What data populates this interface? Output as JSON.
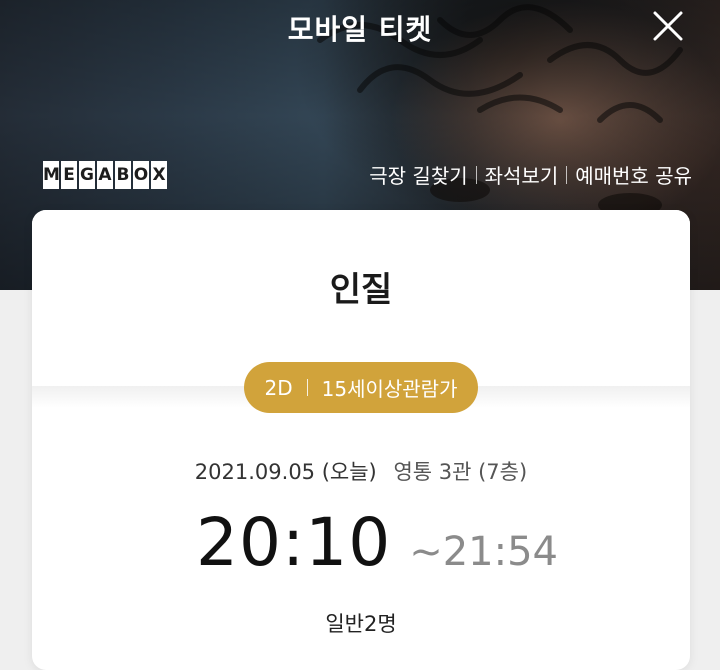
{
  "header": {
    "title": "모바일 티켓",
    "close_icon": "close-icon"
  },
  "brand": {
    "logo_letters": [
      "M",
      "E",
      "G",
      "A",
      "B",
      "O",
      "X"
    ],
    "logo_text": "MEGABOX"
  },
  "links": {
    "find_theater": "극장 길찾기",
    "view_seats": "좌석보기",
    "share_booking": "예매번호 공유"
  },
  "ticket": {
    "movie_title": "인질",
    "format": "2D",
    "rating": "15세이상관람가",
    "date": "2021.09.05 (오늘)",
    "place": "영통 3관 (7층)",
    "start_time": "20:10",
    "end_time": "~21:54",
    "audience": "일반2명"
  },
  "colors": {
    "badge": "#d1a33b",
    "end_time": "#8b8b8b"
  }
}
